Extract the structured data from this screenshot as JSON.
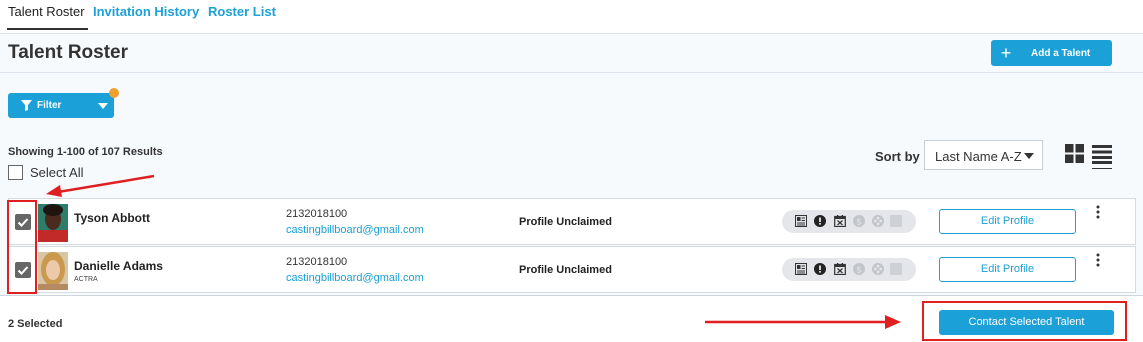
{
  "tabs": [
    {
      "label": "Talent Roster",
      "active": true
    },
    {
      "label": "Invitation History",
      "active": false
    },
    {
      "label": "Roster List",
      "active": false
    }
  ],
  "header": {
    "title": "Talent Roster",
    "add_button_label": "Add a Talent"
  },
  "filter": {
    "label": "Filter",
    "active_indicator_color": "#f0a030"
  },
  "results_text": "Showing 1-100 of 107 Results",
  "select_all_label": "Select All",
  "sort": {
    "label": "Sort by",
    "selected": "Last Name A-Z"
  },
  "view_modes": {
    "options": [
      "grid-view-icon",
      "list-view-icon"
    ],
    "selected": "list-view-icon"
  },
  "rows": [
    {
      "name": "Tyson Abbott",
      "union": "",
      "phone": "2132018100",
      "email": "castingbillboard@gmail.com",
      "status": "Profile Unclaimed",
      "checked": true,
      "edit_label": "Edit Profile"
    },
    {
      "name": "Danielle Adams",
      "union": "ACTRA",
      "phone": "2132018100",
      "email": "castingbillboard@gmail.com",
      "status": "Profile Unclaimed",
      "checked": true,
      "edit_label": "Edit Profile"
    }
  ],
  "status_icons": [
    "resume-icon",
    "alert-icon",
    "calendar-x-icon",
    "dollar-icon",
    "reel-icon",
    "blank-icon"
  ],
  "footer": {
    "selected_count": "2 Selected",
    "contact_button_label": "Contact Selected Talent"
  },
  "colors": {
    "accent": "#1ba0d8",
    "annotation_red": "#e02020"
  }
}
